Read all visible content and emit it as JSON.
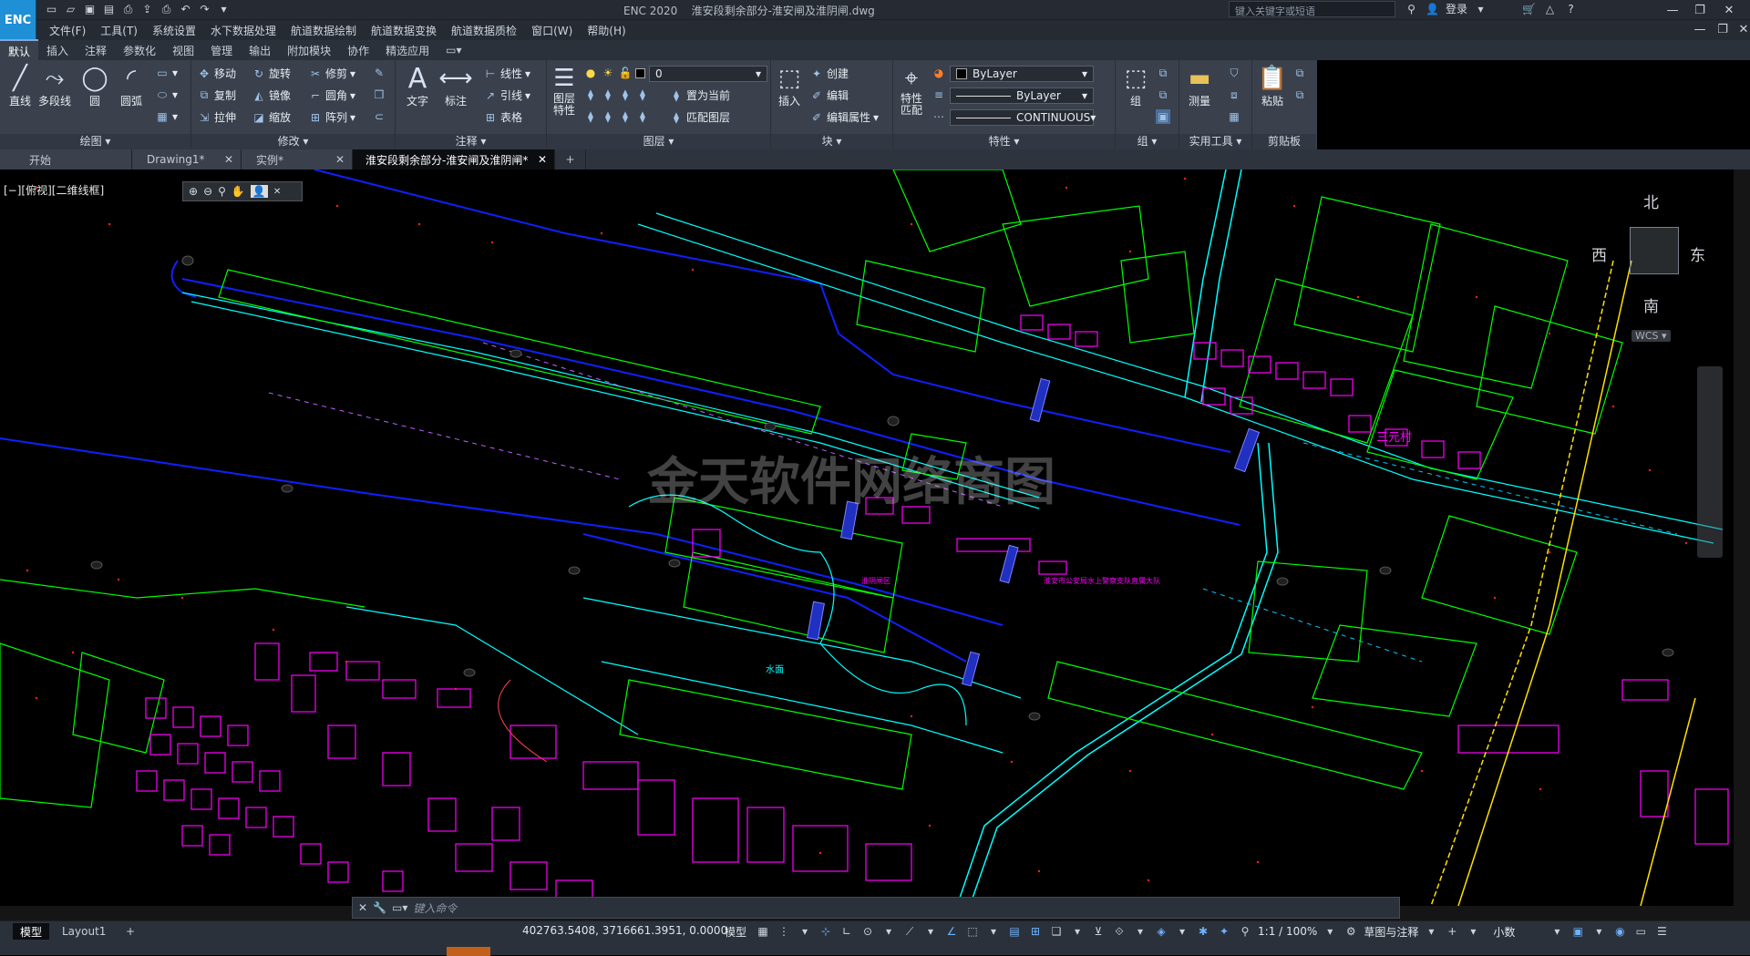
{
  "app": {
    "logo": "ENC",
    "title": "ENC 2020",
    "doc_title": "淮安段剩余部分-淮安闸及淮阴闸.dwg",
    "search_placeholder": "键入关键字或短语",
    "login": "登录"
  },
  "menu": [
    "文件(F)",
    "工具(T)",
    "系统设置",
    "水下数据处理",
    "航道数据绘制",
    "航道数据变换",
    "航道数据质检",
    "窗口(W)",
    "帮助(H)"
  ],
  "ribbon_tabs": [
    "默认",
    "插入",
    "注释",
    "参数化",
    "视图",
    "管理",
    "输出",
    "附加模块",
    "协作",
    "精选应用"
  ],
  "ribbon": {
    "draw": {
      "label": "绘图",
      "line": "直线",
      "polyline": "多段线",
      "circle": "圆",
      "arc": "圆弧"
    },
    "modify": {
      "label": "修改",
      "move": "移动",
      "rotate": "旋转",
      "trim": "修剪",
      "copy": "复制",
      "mirror": "镜像",
      "fillet": "圆角",
      "stretch": "拉伸",
      "scale": "缩放",
      "array": "阵列"
    },
    "annotation": {
      "label": "注释",
      "text": "文字",
      "dim": "标注",
      "linear": "线性",
      "leader": "引线",
      "table": "表格"
    },
    "layers": {
      "label": "图层",
      "props": "图层特性",
      "current_layer": "0",
      "set_current": "置为当前",
      "match": "匹配图层"
    },
    "block": {
      "label": "块",
      "insert": "插入",
      "create": "创建",
      "edit": "编辑",
      "edit_attr": "编辑属性"
    },
    "properties": {
      "label": "特性",
      "match": "特性匹配",
      "color": "ByLayer",
      "lineweight": "ByLayer",
      "linetype": "CONTINUOUS"
    },
    "groups": {
      "label": "组",
      "group": "组"
    },
    "utilities": {
      "label": "实用工具",
      "measure": "测量"
    },
    "clipboard": {
      "label": "剪贴板",
      "paste": "粘贴"
    }
  },
  "doc_tabs": [
    "开始",
    "Drawing1*",
    "实例*",
    "淮安段剩余部分-淮安闸及淮阴闸*"
  ],
  "canvas": {
    "view_label": "[−][俯视][二维线框]",
    "watermark": "金天软件网络商图",
    "labels": {
      "village": "三元村",
      "water": "水面",
      "notice": "淮安市公安局水上警察支队直属大队",
      "park": "淮阴闸区"
    }
  },
  "viewcube": {
    "north": "北",
    "south": "南",
    "east": "东",
    "west": "西",
    "wcs": "WCS"
  },
  "command": {
    "placeholder": "键入命令"
  },
  "status": {
    "tab_model": "模型",
    "tab_layout": "Layout1",
    "coords": "402763.5408, 3716661.3951, 0.0000",
    "model": "模型",
    "scale": "1:1 / 100%",
    "workspace": "草图与注释",
    "units": "小数"
  },
  "colors": {
    "green": "#00ff00",
    "cyan": "#00ffff",
    "magenta": "#ff00ff",
    "blue": "#1020ff",
    "red": "#ff2020",
    "yellow": "#ffe000",
    "accent": "#1f8fd6"
  }
}
